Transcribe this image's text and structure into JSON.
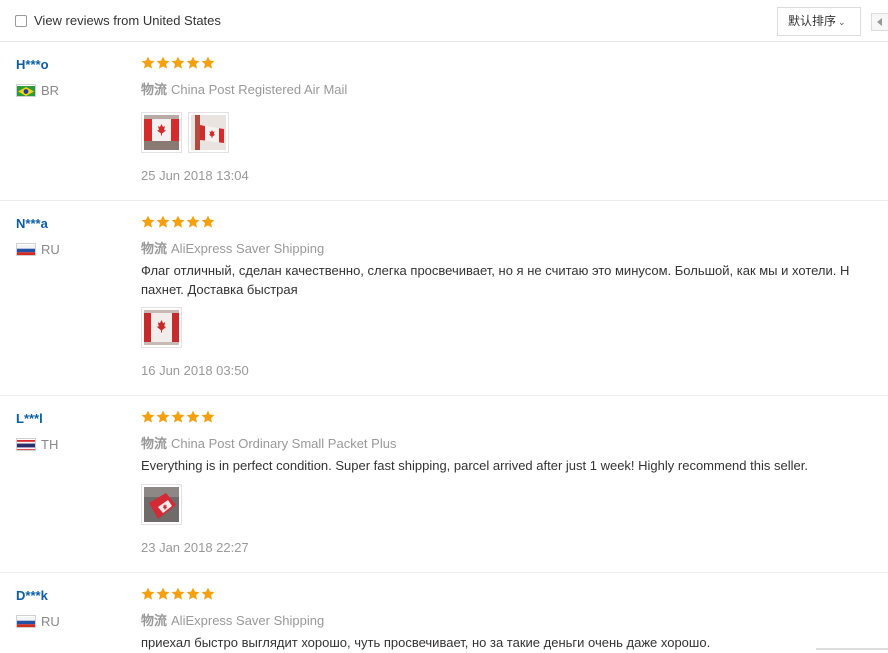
{
  "filter": {
    "label": "View reviews from United States",
    "checked": false
  },
  "sort": {
    "label": "默认排序"
  },
  "reviews": [
    {
      "user": "H***o",
      "country": "BR",
      "flag": "brazil-flag",
      "rating": 5,
      "shipping_label": "物流",
      "shipping": "China Post Registered Air Mail",
      "text": "",
      "photos": [
        "canada-flag-photo",
        "canada-flag-photo"
      ],
      "date": "25 Jun 2018 13:04"
    },
    {
      "user": "N***a",
      "country": "RU",
      "flag": "russia-flag",
      "rating": 5,
      "shipping_label": "物流",
      "shipping": "AliExpress Saver Shipping",
      "text": "Флаг отличный, сделан качественно, слегка просвечивает, но я не считаю это минусом. Большой, как мы и хотели. Н\nпахнет. Доставка быстрая",
      "photos": [
        "canada-flag-photo"
      ],
      "date": "16 Jun 2018 03:50"
    },
    {
      "user": "L***l",
      "country": "TH",
      "flag": "thailand-flag",
      "rating": 5,
      "shipping_label": "物流",
      "shipping": "China Post Ordinary Small Packet Plus",
      "text": "Everything is in perfect condition. Super fast shipping, parcel arrived after just 1 week! Highly recommend this seller.",
      "photos": [
        "folded-flag-photo"
      ],
      "date": "23 Jan 2018 22:27"
    },
    {
      "user": "D***k",
      "country": "RU",
      "flag": "russia-flag",
      "rating": 5,
      "shipping_label": "物流",
      "shipping": "AliExpress Saver Shipping",
      "text": "приехал быстро выглядит хорошо, чуть просвечивает, но за такие деньги очень даже хорошо.",
      "photos": [],
      "date": ""
    }
  ],
  "colors": {
    "star": "#f5a00f",
    "username": "#0b5ea8",
    "muted": "#999999"
  }
}
